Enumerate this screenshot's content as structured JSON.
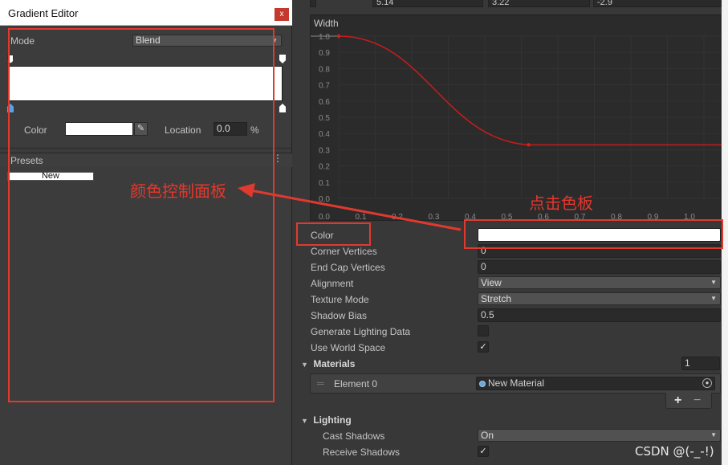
{
  "gradient_editor": {
    "title": "Gradient Editor",
    "close_glyph": "x",
    "mode_label": "Mode",
    "mode_value": "Blend",
    "color_label": "Color",
    "color_value": "#ffffff",
    "eyedropper_glyph": "✎",
    "location_label": "Location",
    "location_value": "0.0",
    "location_unit": "%",
    "presets_label": "Presets",
    "presets_menu_glyph": "⋮",
    "preset_new_label": "New"
  },
  "inspector": {
    "top_values": [
      "5.14",
      "3.22",
      "-2.9"
    ],
    "curve": {
      "label": "Width",
      "y_ticks": [
        "1.0",
        "0.9",
        "0.8",
        "0.7",
        "0.6",
        "0.5",
        "0.4",
        "0.3",
        "0.2",
        "0.1",
        "0.0"
      ],
      "x_ticks": [
        "0.0",
        "0.1",
        "0.2",
        "0.3",
        "0.4",
        "0.5",
        "0.6",
        "0.7",
        "0.8",
        "0.9",
        "1.0"
      ],
      "keys": [
        {
          "t": 0.0,
          "v": 1.0
        },
        {
          "t": 0.52,
          "v": 0.33
        }
      ]
    },
    "properties": [
      {
        "label": "Color",
        "type": "color",
        "value": "#ffffff"
      },
      {
        "label": "Corner Vertices",
        "type": "text",
        "value": "0"
      },
      {
        "label": "End Cap Vertices",
        "type": "text",
        "value": "0"
      },
      {
        "label": "Alignment",
        "type": "dropdown",
        "value": "View"
      },
      {
        "label": "Texture Mode",
        "type": "dropdown",
        "value": "Stretch"
      },
      {
        "label": "Shadow Bias",
        "type": "text",
        "value": "0.5"
      },
      {
        "label": "Generate Lighting Data",
        "type": "checkbox",
        "value": ""
      },
      {
        "label": "Use World Space",
        "type": "checkbox",
        "value": "✓"
      }
    ],
    "materials": {
      "label": "Materials",
      "count": "1",
      "element_label": "Element 0",
      "element_value": "New Material",
      "add_glyph": "+",
      "remove_glyph": "−"
    },
    "lighting": {
      "label": "Lighting",
      "cast_shadows_label": "Cast Shadows",
      "cast_shadows_value": "On",
      "receive_shadows_label": "Receive Shadows",
      "receive_shadows_value": "✓"
    },
    "foldout_glyph": "▼",
    "dropdown_glyph": "▼"
  },
  "annotations": {
    "panel_note": "颜色控制面板",
    "click_note": "点击色板",
    "accent_color": "#e03a2f"
  },
  "watermark": "CSDN @(-_-!)"
}
